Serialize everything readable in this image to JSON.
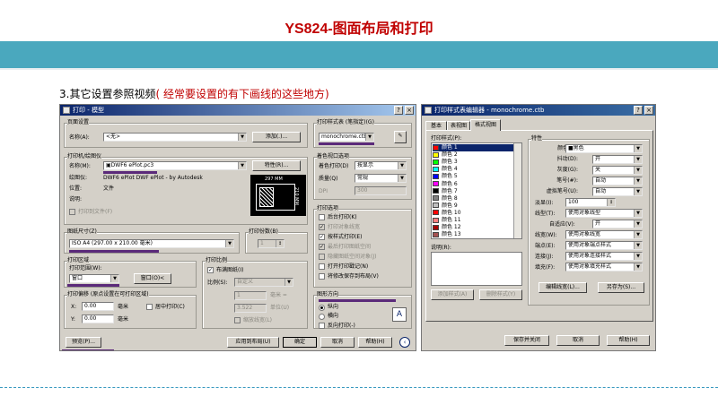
{
  "slide": {
    "title": "YS824-图面布局和打印",
    "subtitle_main": "3.其它设置参照视频",
    "subtitle_note": "( 经常要设置的有下画线的这些地方)"
  },
  "colors": {
    "band": "#4aa8be",
    "title": "#c00000",
    "titlebar": "#0a246a",
    "underline": "#5b2a7a"
  },
  "print_dialog": {
    "title": "打印 - 模型",
    "page_setup": {
      "label": "页面设置",
      "name_label": "名称(A):",
      "name_value": "<无>",
      "add_btn": "添加(.)..."
    },
    "printer": {
      "label": "打印机/绘图仪",
      "name_label": "名称(M):",
      "name_value": "DWF6 ePlot.pc3",
      "props_btn": "特性(R)...",
      "plotter_label": "绘图仪:",
      "plotter_value": "DWF6 ePlot DWF ePlot - by Autodesk",
      "location_label": "位置:",
      "location_value": "文件",
      "desc_label": "说明:",
      "to_file": "打印到文件(F)",
      "preview_w": "297 MM",
      "preview_h": "210 MM"
    },
    "paper": {
      "label": "图纸尺寸(Z)",
      "value": "ISO A4 (297.00 x 210.00 毫米)"
    },
    "copies": {
      "label": "打印份数(B)",
      "value": "1"
    },
    "area": {
      "label": "打印区域",
      "range_label": "打印范围(W):",
      "range_value": "窗口",
      "window_btn": "窗口(O)<"
    },
    "offset": {
      "label": "打印偏移 (原点设置在可打印区域)",
      "x_label": "X:",
      "x_value": "0.00",
      "x_unit": "毫米",
      "center": "居中打印(C)",
      "y_label": "Y:",
      "y_value": "0.00",
      "y_unit": "毫米"
    },
    "scale": {
      "label": "打印比例",
      "fit": "布满图纸(I)",
      "ratio_label": "比例(S):",
      "ratio_value": "自定义",
      "v1": "1",
      "u1": "毫米 =",
      "v2": "3.522",
      "u2": "单位(U)",
      "lineweights": "缩放线宽(L)"
    },
    "style_table": {
      "label": "打印样式表 (笔指定)(G)",
      "value": "monochrome.ctb"
    },
    "shaded": {
      "label": "着色视口选项",
      "shade_label": "着色打印(D)",
      "shade_value": "按显示",
      "quality_label": "质量(Q)",
      "quality_value": "常规",
      "dpi_label": "DPI",
      "dpi_value": "300"
    },
    "options": {
      "label": "打印选项",
      "items": [
        {
          "text": "后台打印(K)",
          "checked": false,
          "disabled": false
        },
        {
          "text": "打印对象线宽",
          "checked": true,
          "disabled": true
        },
        {
          "text": "按样式打印(E)",
          "checked": true,
          "disabled": false
        },
        {
          "text": "最后打印图纸空间",
          "checked": true,
          "disabled": true
        },
        {
          "text": "隐藏图纸空间对象(J)",
          "checked": false,
          "disabled": true
        },
        {
          "text": "打开打印戳记(N)",
          "checked": false,
          "disabled": false
        },
        {
          "text": "将修改保存到布局(V)",
          "checked": false,
          "disabled": false
        }
      ]
    },
    "orientation": {
      "label": "图形方向",
      "portrait": "纵向",
      "landscape": "横向",
      "reverse": "反向打印(-)"
    },
    "buttons": {
      "preview": "预览(P)...",
      "apply": "应用到布局(U)",
      "ok": "确定",
      "cancel": "取消",
      "help": "帮助(H)"
    }
  },
  "ctb_editor": {
    "title": "打印样式表编辑器 - monochrome.ctb",
    "tabs": [
      "基本",
      "表视图",
      "格式视图"
    ],
    "styles_label": "打印样式(P):",
    "styles": [
      {
        "name": "颜色 1",
        "color": "#ff0000"
      },
      {
        "name": "颜色 2",
        "color": "#ffff00"
      },
      {
        "name": "颜色 3",
        "color": "#00ff00"
      },
      {
        "name": "颜色 4",
        "color": "#00ffff"
      },
      {
        "name": "颜色 5",
        "color": "#0000ff"
      },
      {
        "name": "颜色 6",
        "color": "#ff00ff"
      },
      {
        "name": "颜色 7",
        "color": "#000000"
      },
      {
        "name": "颜色 8",
        "color": "#808080"
      },
      {
        "name": "颜色 9",
        "color": "#c0c0c0"
      },
      {
        "name": "颜色 10",
        "color": "#ff0000"
      },
      {
        "name": "颜色 11",
        "color": "#ff7f7f"
      },
      {
        "name": "颜色 12",
        "color": "#a50000"
      },
      {
        "name": "颜色 13",
        "color": "#a55252"
      }
    ],
    "desc_label": "说明(R):",
    "props_label": "特性",
    "props": [
      {
        "label": "颜色(C):",
        "value": "■黑色"
      },
      {
        "label": "抖动(D):",
        "value": "开"
      },
      {
        "label": "灰度(G):",
        "value": "关"
      },
      {
        "label": "笔号(#):",
        "value": "自动"
      },
      {
        "label": "虚拟笔号(U):",
        "value": "自动"
      }
    ],
    "screening_label": "淡显(I):",
    "screening_value": "100",
    "linetype_label": "线型(T):",
    "linetype_value": "使用对象线型",
    "adaptive_label": "自适应(V):",
    "adaptive_value": "开",
    "lineweight_label": "线宽(W):",
    "lineweight_value": "使用对象线宽",
    "endstyle_label": "端点(E):",
    "endstyle_value": "使用对象端点样式",
    "joinstyle_label": "连接(J):",
    "joinstyle_value": "使用对象连接样式",
    "fill_label": "填充(F):",
    "fill_value": "使用对象填充样式",
    "add_btn": "添加样式(A)",
    "del_btn": "删除样式(Y)",
    "edit_lw_btn": "编辑线宽(L)...",
    "saveas_btn": "另存为(S)...",
    "save_close": "保存并关闭",
    "cancel": "取消",
    "help": "帮助(H)"
  }
}
